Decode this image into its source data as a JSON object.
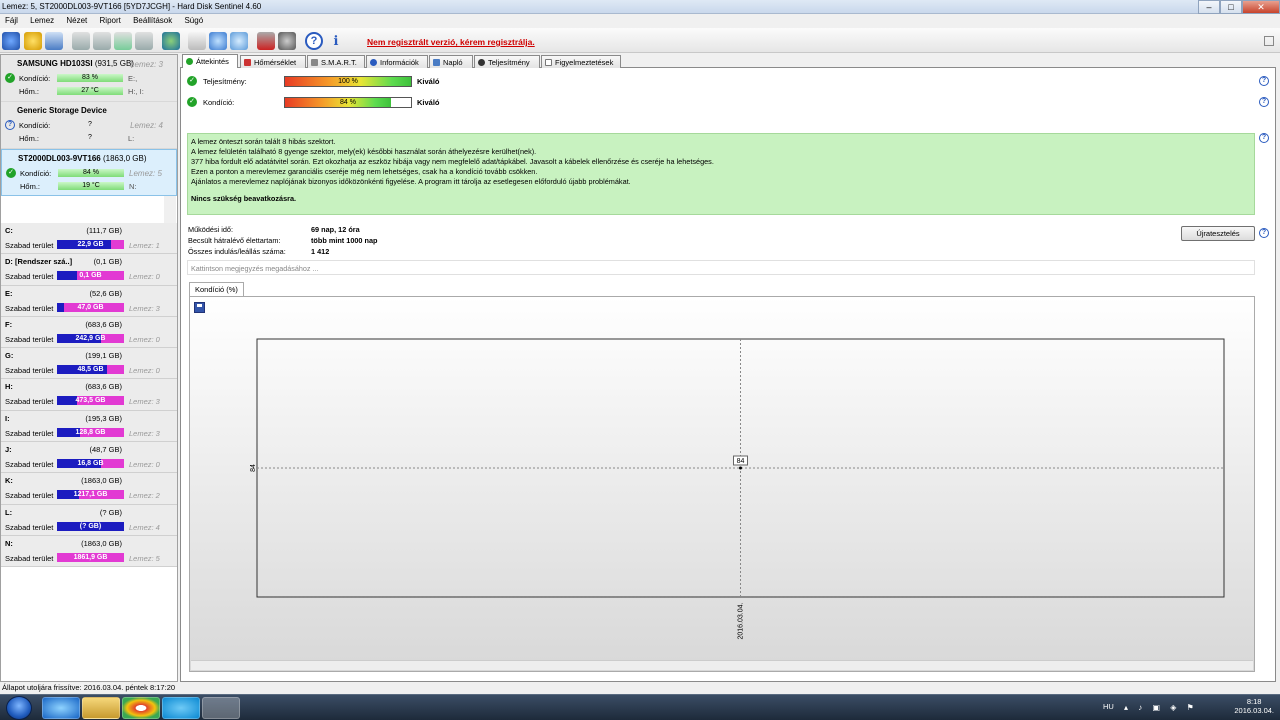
{
  "window": {
    "title": "Lemez: 5, ST2000DL003-9VT166 [5YD7JCGH]  -  Hard Disk Sentinel 4.60"
  },
  "menu": [
    "Fájl",
    "Lemez",
    "Nézet",
    "Riport",
    "Beállítások",
    "Súgó"
  ],
  "toolbar": {
    "register_link": "Nem regisztrált verzió, kérem regisztrálja."
  },
  "disks": [
    {
      "name": "SAMSUNG HD103SI",
      "size": "(931,5 GB)",
      "lemez": "Lemez: 3",
      "kondicio_label": "Kondíció:",
      "kondicio": "83 %",
      "kondicio_value": 83,
      "hom_label": "Hőm.:",
      "hom": "27 °C",
      "hom_value": 27,
      "r1": "E:,",
      "r2": "H:, I:",
      "status": "ok"
    },
    {
      "name": "Generic Storage Device",
      "size": "",
      "lemez": "Lemez: 4",
      "kondicio_label": "Kondíció:",
      "kondicio": "?",
      "hom_label": "Hőm.:",
      "hom": "?",
      "r1": "L:",
      "r2": "",
      "status": "unknown"
    },
    {
      "name": "ST2000DL003-9VT166",
      "size": "(1863,0 GB)",
      "lemez": "Lemez: 5",
      "kondicio_label": "Kondíció:",
      "kondicio": "84 %",
      "kondicio_value": 84,
      "hom_label": "Hőm.:",
      "hom": "19 °C",
      "hom_value": 19,
      "r1": "N:",
      "r2": "",
      "status": "ok"
    }
  ],
  "volumes": [
    {
      "letter": "C:",
      "size": "(111,7 GB)",
      "free_label": "Szabad terület",
      "free": "22,9 GB",
      "free_frac": 0.8,
      "lemez": "Lemez: 1"
    },
    {
      "letter": "D: [Rendszer szá..]",
      "size": "(0,1 GB)",
      "free_label": "Szabad terület",
      "free": "0,1 GB",
      "free_frac": 0.3,
      "lemez": "Lemez: 0"
    },
    {
      "letter": "E:",
      "size": "(52,6 GB)",
      "free_label": "Szabad terület",
      "free": "47,0 GB",
      "free_frac": 0.1,
      "lemez": "Lemez: 3"
    },
    {
      "letter": "F:",
      "size": "(683,6 GB)",
      "free_label": "Szabad terület",
      "free": "242,9 GB",
      "free_frac": 0.65,
      "lemez": "Lemez: 0"
    },
    {
      "letter": "G:",
      "size": "(199,1 GB)",
      "free_label": "Szabad terület",
      "free": "48,5 GB",
      "free_frac": 0.75,
      "lemez": "Lemez: 0"
    },
    {
      "letter": "H:",
      "size": "(683,6 GB)",
      "free_label": "Szabad terület",
      "free": "473,5 GB",
      "free_frac": 0.3,
      "lemez": "Lemez: 3"
    },
    {
      "letter": "I:",
      "size": "(195,3 GB)",
      "free_label": "Szabad terület",
      "free": "128,8 GB",
      "free_frac": 0.35,
      "lemez": "Lemez: 3"
    },
    {
      "letter": "J:",
      "size": "(48,7 GB)",
      "free_label": "Szabad terület",
      "free": "16,8 GB",
      "free_frac": 0.65,
      "lemez": "Lemez: 0"
    },
    {
      "letter": "K:",
      "size": "(1863,0 GB)",
      "free_label": "Szabad terület",
      "free": "1217,1 GB",
      "free_frac": 0.33,
      "lemez": "Lemez: 2"
    },
    {
      "letter": "L:",
      "size": "(? GB)",
      "free_label": "Szabad terület",
      "free": "(? GB)",
      "free_frac": 1.0,
      "lemez": "Lemez: 4"
    },
    {
      "letter": "N:",
      "size": "(1863,0 GB)",
      "free_label": "Szabad terület",
      "free": "1861,9 GB",
      "free_frac": 0.0,
      "lemez": "Lemez: 5"
    }
  ],
  "tabs": [
    "Áttekintés",
    "Hőmérséklet",
    "S.M.A.R.T.",
    "Információk",
    "Napló",
    "Teljesítmény",
    "Figyelmeztetések"
  ],
  "overview": {
    "perf_label": "Teljesítmény:",
    "perf_text": "100 %",
    "perf_value": 100,
    "perf_rating": "Kiváló",
    "cond_label": "Kondíció:",
    "cond_text": "84 %",
    "cond_value": 84,
    "cond_rating": "Kiváló",
    "message_lines": [
      "A lemez önteszt során talált 8 hibás szektort.",
      "A lemez felületén található 8 gyenge szektor, mely(ek) későbbi használat során áthelyezésre kerülhet(nek).",
      "377 hiba fordult elő adatátvitel során. Ezt okozhatja az eszköz hibája vagy nem megfelelő adat/tápkábel. Javasolt a kábelek ellenőrzése és cseréje ha lehetséges.",
      "Ezen a ponton a merevlemez garanciális cseréje még nem lehetséges, csak ha a kondíció tovább csökken.",
      "Ajánlatos a merevlemez naplójának bizonyos időközönkénti figyelése. A program itt tárolja az esetlegesen előforduló újabb problémákat."
    ],
    "message_bold": "Nincs szükség beavatkozásra.",
    "uptime_label": "Működési idő:",
    "uptime": "69 nap, 12 óra",
    "lifetime_label": "Becsült hátralévő élettartam:",
    "lifetime": "több mint 1000 nap",
    "starts_label": "Összes indulás/leállás száma:",
    "starts": "1 412",
    "retest_button": "Újratesztelés",
    "note_placeholder": "Kattintson megjegyzés megadásához ...",
    "chart_tab": "Kondíció  (%)"
  },
  "chart_data": {
    "type": "line",
    "x": [
      "2016.03.04."
    ],
    "series": [
      {
        "values": [
          84
        ]
      }
    ],
    "data_labels": [
      "84"
    ],
    "y_tick_labels": [
      "84"
    ],
    "x_tick_labels": [
      "2016.03.04."
    ],
    "grid": true
  },
  "status_bar": "Állapot utoljára frissítve: 2016.03.04. péntek 8:17:20",
  "taskbar": {
    "lang": "HU",
    "time": "8:18",
    "date": "2016.03.04."
  },
  "colors": {
    "volume_used": "#1c1cc0",
    "volume_free": "#e23ad3",
    "message_bg": "#c8f2c0",
    "register_link": "#d00000",
    "ok_icon": "#22a329"
  }
}
